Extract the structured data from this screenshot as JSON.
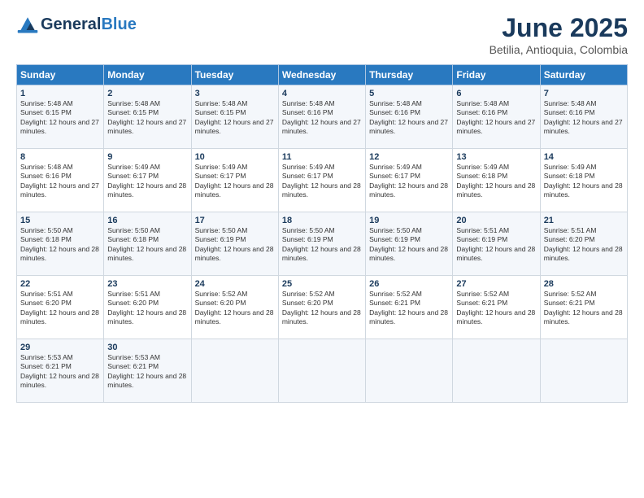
{
  "header": {
    "logo_general": "General",
    "logo_blue": "Blue",
    "month_title": "June 2025",
    "subtitle": "Betilia, Antioquia, Colombia"
  },
  "weekdays": [
    "Sunday",
    "Monday",
    "Tuesday",
    "Wednesday",
    "Thursday",
    "Friday",
    "Saturday"
  ],
  "weeks": [
    [
      {
        "day": "1",
        "sunrise": "5:48 AM",
        "sunset": "6:15 PM",
        "daylight": "12 hours and 27 minutes."
      },
      {
        "day": "2",
        "sunrise": "5:48 AM",
        "sunset": "6:15 PM",
        "daylight": "12 hours and 27 minutes."
      },
      {
        "day": "3",
        "sunrise": "5:48 AM",
        "sunset": "6:15 PM",
        "daylight": "12 hours and 27 minutes."
      },
      {
        "day": "4",
        "sunrise": "5:48 AM",
        "sunset": "6:16 PM",
        "daylight": "12 hours and 27 minutes."
      },
      {
        "day": "5",
        "sunrise": "5:48 AM",
        "sunset": "6:16 PM",
        "daylight": "12 hours and 27 minutes."
      },
      {
        "day": "6",
        "sunrise": "5:48 AM",
        "sunset": "6:16 PM",
        "daylight": "12 hours and 27 minutes."
      },
      {
        "day": "7",
        "sunrise": "5:48 AM",
        "sunset": "6:16 PM",
        "daylight": "12 hours and 27 minutes."
      }
    ],
    [
      {
        "day": "8",
        "sunrise": "5:48 AM",
        "sunset": "6:16 PM",
        "daylight": "12 hours and 27 minutes."
      },
      {
        "day": "9",
        "sunrise": "5:49 AM",
        "sunset": "6:17 PM",
        "daylight": "12 hours and 28 minutes."
      },
      {
        "day": "10",
        "sunrise": "5:49 AM",
        "sunset": "6:17 PM",
        "daylight": "12 hours and 28 minutes."
      },
      {
        "day": "11",
        "sunrise": "5:49 AM",
        "sunset": "6:17 PM",
        "daylight": "12 hours and 28 minutes."
      },
      {
        "day": "12",
        "sunrise": "5:49 AM",
        "sunset": "6:17 PM",
        "daylight": "12 hours and 28 minutes."
      },
      {
        "day": "13",
        "sunrise": "5:49 AM",
        "sunset": "6:18 PM",
        "daylight": "12 hours and 28 minutes."
      },
      {
        "day": "14",
        "sunrise": "5:49 AM",
        "sunset": "6:18 PM",
        "daylight": "12 hours and 28 minutes."
      }
    ],
    [
      {
        "day": "15",
        "sunrise": "5:50 AM",
        "sunset": "6:18 PM",
        "daylight": "12 hours and 28 minutes."
      },
      {
        "day": "16",
        "sunrise": "5:50 AM",
        "sunset": "6:18 PM",
        "daylight": "12 hours and 28 minutes."
      },
      {
        "day": "17",
        "sunrise": "5:50 AM",
        "sunset": "6:19 PM",
        "daylight": "12 hours and 28 minutes."
      },
      {
        "day": "18",
        "sunrise": "5:50 AM",
        "sunset": "6:19 PM",
        "daylight": "12 hours and 28 minutes."
      },
      {
        "day": "19",
        "sunrise": "5:50 AM",
        "sunset": "6:19 PM",
        "daylight": "12 hours and 28 minutes."
      },
      {
        "day": "20",
        "sunrise": "5:51 AM",
        "sunset": "6:19 PM",
        "daylight": "12 hours and 28 minutes."
      },
      {
        "day": "21",
        "sunrise": "5:51 AM",
        "sunset": "6:20 PM",
        "daylight": "12 hours and 28 minutes."
      }
    ],
    [
      {
        "day": "22",
        "sunrise": "5:51 AM",
        "sunset": "6:20 PM",
        "daylight": "12 hours and 28 minutes."
      },
      {
        "day": "23",
        "sunrise": "5:51 AM",
        "sunset": "6:20 PM",
        "daylight": "12 hours and 28 minutes."
      },
      {
        "day": "24",
        "sunrise": "5:52 AM",
        "sunset": "6:20 PM",
        "daylight": "12 hours and 28 minutes."
      },
      {
        "day": "25",
        "sunrise": "5:52 AM",
        "sunset": "6:20 PM",
        "daylight": "12 hours and 28 minutes."
      },
      {
        "day": "26",
        "sunrise": "5:52 AM",
        "sunset": "6:21 PM",
        "daylight": "12 hours and 28 minutes."
      },
      {
        "day": "27",
        "sunrise": "5:52 AM",
        "sunset": "6:21 PM",
        "daylight": "12 hours and 28 minutes."
      },
      {
        "day": "28",
        "sunrise": "5:52 AM",
        "sunset": "6:21 PM",
        "daylight": "12 hours and 28 minutes."
      }
    ],
    [
      {
        "day": "29",
        "sunrise": "5:53 AM",
        "sunset": "6:21 PM",
        "daylight": "12 hours and 28 minutes."
      },
      {
        "day": "30",
        "sunrise": "5:53 AM",
        "sunset": "6:21 PM",
        "daylight": "12 hours and 28 minutes."
      },
      null,
      null,
      null,
      null,
      null
    ]
  ]
}
